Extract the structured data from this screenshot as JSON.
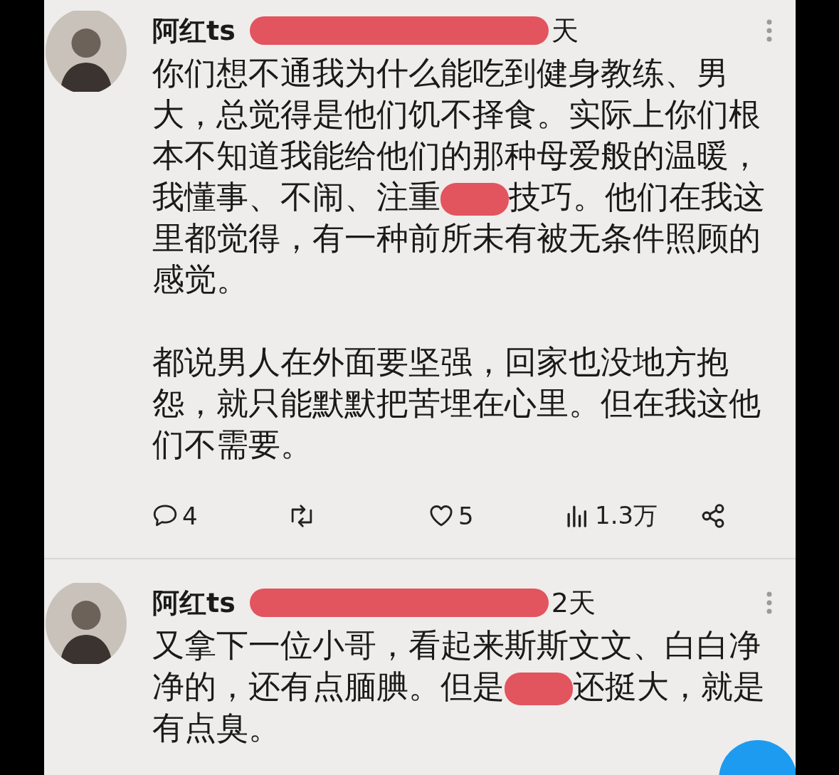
{
  "posts": [
    {
      "author": "阿红ts",
      "time": "天",
      "body": [
        [
          {
            "kind": "text",
            "text": "你们想不通我为什么能吃到健身教练、男大，总觉得是他们饥不择食。实际上你们根本不知道我能给他们的那种母爱般的温暖，我懂事、不闹、注重"
          },
          {
            "kind": "redaction"
          },
          {
            "kind": "text",
            "text": "技巧。他们在我这里都觉得，有一种前所未有被无条件照顾的感觉。"
          }
        ],
        [
          {
            "kind": "text",
            "text": "都说男人在外面要坚强，回家也没地方抱怨，就只能默默把苦埋在心里。但在我这他们不需要。"
          }
        ]
      ],
      "actions": [
        {
          "kind": "reply",
          "count": "4"
        },
        {
          "kind": "repost"
        },
        {
          "kind": "like",
          "count": "5"
        },
        {
          "kind": "views",
          "count": "1.3万"
        },
        {
          "kind": "share"
        }
      ]
    },
    {
      "author": "阿红ts",
      "time": "2天",
      "body": [
        [
          {
            "kind": "text",
            "text": "又拿下一位小哥，看起来斯斯文文、白白净净的，还有点腼腆。但是"
          },
          {
            "kind": "redaction"
          },
          {
            "kind": "text",
            "text": "还挺大，就是有点臭。"
          }
        ]
      ]
    }
  ],
  "floating_button": {
    "kind": "round"
  }
}
